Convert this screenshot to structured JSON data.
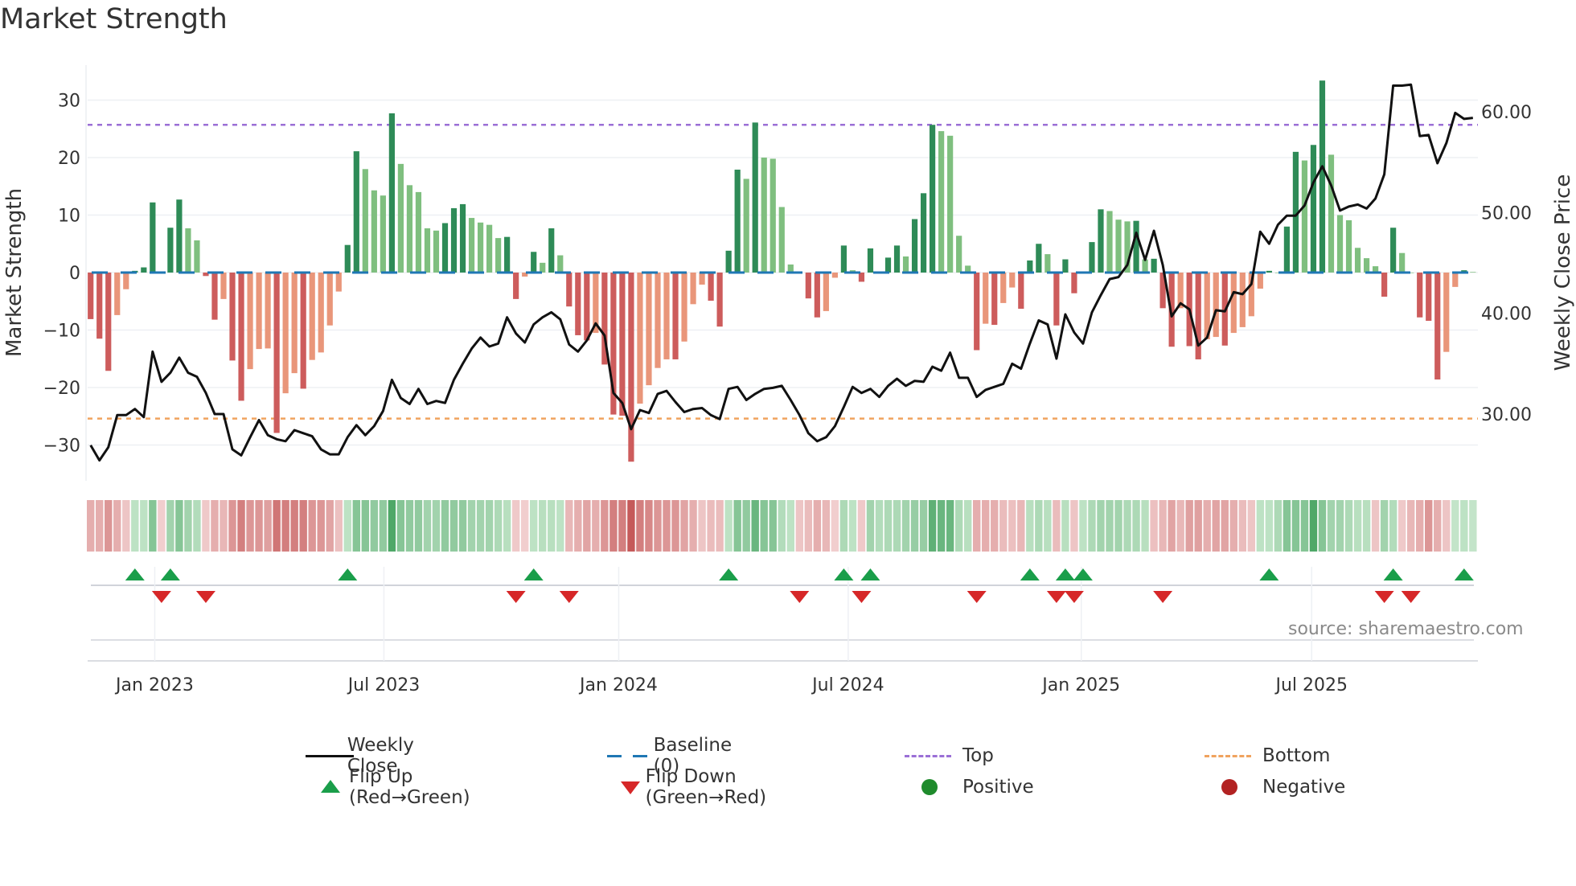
{
  "title": "Market Strength",
  "source": "source: sharemaestro.com",
  "legend": {
    "weekly_close": "Weekly Close",
    "baseline": "Baseline (0)",
    "top": "Top",
    "bottom": "Bottom",
    "flip_up": "Flip Up (Red→Green)",
    "flip_down": "Flip Down (Green→Red)",
    "positive": "Positive",
    "negative": "Negative"
  },
  "colors": {
    "price_line": "#111111",
    "baseline": "#1f77b4",
    "top": "#9b6fd6",
    "bottom": "#f0a35e",
    "bar_pos_rising": "#2e8b57",
    "bar_pos_falling": "#7fbf7f",
    "bar_neg_falling": "#cd5c5c",
    "bar_neg_rising": "#e9967a",
    "flip_up": "#1a9e4a",
    "flip_down": "#d62728",
    "positive": "#1f8b2c",
    "negative": "#b22222"
  },
  "chart_data": {
    "type": "bar",
    "title": "Market Strength",
    "ylabel": "Market Strength",
    "y2label": "Weekly Close Price",
    "ylim": [
      -36,
      36
    ],
    "y2lim": [
      23.4,
      64.6
    ],
    "yticks": [
      30,
      20,
      10,
      0,
      -10,
      -20,
      -30
    ],
    "ytick_labels": [
      "30",
      "20",
      "10",
      "0",
      "−10",
      "−20",
      "−30"
    ],
    "y2ticks": [
      60,
      50,
      40,
      30
    ],
    "y2tick_labels": [
      "60.00",
      "50.00",
      "40.00",
      "30.00"
    ],
    "xticks": [
      {
        "label": "Jan 2023",
        "week": 8.24
      },
      {
        "label": "Jul 2023",
        "week": 34.1
      },
      {
        "label": "Jan 2024",
        "week": 60.6
      },
      {
        "label": "Jul 2024",
        "week": 86.5
      },
      {
        "label": "Jan 2025",
        "week": 112.8
      },
      {
        "label": "Jul 2025",
        "week": 138.8
      }
    ],
    "top_level": 25.7,
    "bottom_level": -25.4,
    "baseline": 0,
    "strength": [
      -8.1,
      -11.5,
      -17.1,
      -7.4,
      -2.9,
      0.3,
      0.9,
      12.2,
      -0.2,
      7.8,
      12.7,
      7.7,
      5.6,
      -0.6,
      -8.2,
      -4.6,
      -15.3,
      -22.3,
      -16.8,
      -13.3,
      -13.2,
      -27.9,
      -21.0,
      -17.5,
      -20.2,
      -15.2,
      -13.9,
      -9.2,
      -3.3,
      4.8,
      21.1,
      18.0,
      14.3,
      13.4,
      27.7,
      18.9,
      15.2,
      14.0,
      7.7,
      7.3,
      8.6,
      11.2,
      11.9,
      9.5,
      8.7,
      8.3,
      6.0,
      6.2,
      -4.6,
      -0.7,
      3.6,
      1.7,
      7.7,
      3.0,
      -5.9,
      -10.9,
      -11.8,
      -10.5,
      -16.0,
      -24.7,
      -24.9,
      -32.9,
      -22.8,
      -19.6,
      -16.6,
      -15.1,
      -15.1,
      -12.0,
      -5.5,
      -2.1,
      -4.9,
      -9.4,
      3.8,
      17.9,
      16.3,
      26.1,
      20.0,
      19.8,
      11.4,
      1.4,
      0,
      -4.5,
      -7.8,
      -6.7,
      -0.9,
      4.7,
      0.4,
      -1.6,
      4.2,
      0.2,
      2.6,
      4.7,
      2.8,
      9.3,
      13.8,
      25.7,
      24.6,
      23.8,
      6.4,
      1.2,
      -13.5,
      -8.9,
      -9.1,
      -5.3,
      -2.6,
      -6.3,
      2.1,
      5.0,
      3.2,
      -9.2,
      2.3,
      -3.6,
      0.2,
      5.3,
      11.0,
      10.7,
      9.2,
      8.9,
      9.0,
      2.3,
      2.4,
      -6.2,
      -12.9,
      -6.2,
      -12.8,
      -15.1,
      -11.6,
      -11.2,
      -12.7,
      -10.5,
      -9.5,
      -7.6,
      -2.8,
      0.3,
      0,
      8.0,
      21.0,
      19.5,
      22.2,
      33.4,
      20.5,
      10.0,
      9.1,
      4.3,
      2.5,
      1.1,
      -4.2,
      7.8,
      3.4,
      0,
      -7.8,
      -8.4,
      -18.6,
      -13.8,
      -2.5,
      0.4,
      0.1
    ],
    "weekly_close": [
      26.9,
      25.4,
      26.7,
      29.9,
      29.9,
      30.5,
      29.7,
      36.2,
      33.2,
      34.1,
      35.6,
      34.1,
      33.7,
      32.1,
      30.0,
      30.0,
      26.5,
      25.9,
      27.7,
      29.4,
      27.9,
      27.5,
      27.3,
      28.4,
      28.1,
      27.8,
      26.5,
      26.0,
      26.0,
      27.7,
      28.9,
      27.9,
      28.8,
      30.3,
      33.4,
      31.6,
      31.0,
      32.5,
      31.0,
      31.3,
      31.1,
      33.4,
      35.0,
      36.5,
      37.6,
      36.7,
      37.0,
      39.6,
      38.0,
      37.1,
      38.9,
      39.6,
      40.1,
      39.4,
      36.9,
      36.2,
      37.3,
      39.0,
      37.8,
      32.1,
      31.1,
      28.5,
      30.4,
      30.1,
      32.0,
      32.3,
      31.2,
      30.2,
      30.5,
      30.6,
      29.9,
      29.5,
      32.5,
      32.7,
      31.4,
      32.0,
      32.5,
      32.6,
      32.8,
      31.4,
      29.9,
      28.1,
      27.3,
      27.7,
      28.8,
      30.7,
      32.7,
      32.1,
      32.5,
      31.7,
      32.8,
      33.5,
      32.8,
      33.3,
      33.2,
      34.7,
      34.3,
      36.1,
      33.6,
      33.6,
      31.7,
      32.4,
      32.7,
      33.0,
      35.0,
      34.5,
      37.0,
      39.3,
      38.9,
      35.5,
      39.9,
      38.1,
      37.0,
      40.1,
      41.8,
      43.4,
      43.6,
      44.8,
      48.0,
      45.3,
      48.2,
      44.8,
      39.7,
      41.0,
      40.4,
      36.8,
      37.6,
      40.3,
      40.2,
      42.1,
      41.9,
      42.9,
      48.1,
      46.9,
      48.8,
      49.7,
      49.7,
      50.7,
      53.0,
      54.6,
      52.7,
      50.2,
      50.6,
      50.8,
      50.4,
      51.4,
      53.8,
      62.6,
      62.6,
      62.7,
      57.6,
      57.7,
      54.9,
      56.9,
      59.9,
      59.3,
      59.4
    ],
    "heat_levels": [
      -1,
      -1,
      -1.5,
      -1,
      -0.5,
      0.5,
      0.5,
      1.5,
      -0.3,
      1,
      1.5,
      1,
      0.7,
      -0.4,
      -1,
      -0.8,
      -1.5,
      -2,
      -1.5,
      -1.5,
      -1.3,
      -2.2,
      -2,
      -2,
      -2,
      -1.5,
      -1.5,
      -1.2,
      -0.6,
      0.5,
      1.5,
      1.5,
      1.3,
      1.3,
      2.5,
      1.5,
      1.3,
      1.3,
      1,
      1,
      1.3,
      1.3,
      1.3,
      1,
      1,
      1,
      0.8,
      0.6,
      -0.4,
      -0.3,
      0.5,
      0.6,
      0.6,
      0.5,
      -0.8,
      -1,
      -1.2,
      -1,
      -1.5,
      -2,
      -2,
      -2.8,
      -2,
      -1.8,
      -1.5,
      -1.5,
      -1.5,
      -1.2,
      -1,
      -0.5,
      -0.7,
      -0.7,
      0.5,
      1.5,
      1.3,
      2,
      1.5,
      1.5,
      0.7,
      0.5,
      -0.5,
      -0.7,
      -1,
      -0.8,
      -0.3,
      0.8,
      0.5,
      -0.4,
      1,
      0.7,
      0.8,
      0.8,
      1,
      1.2,
      1.2,
      2.2,
      2,
      2,
      0.8,
      0.6,
      -1,
      -1,
      -1,
      -0.7,
      -0.6,
      -0.8,
      0.6,
      0.8,
      0.6,
      -0.7,
      0.6,
      -0.5,
      0.5,
      0.8,
      1,
      1,
      1,
      0.8,
      0.8,
      0.6,
      -0.6,
      -0.8,
      -1.2,
      -0.8,
      -1.3,
      -1.3,
      -1,
      -1.2,
      -1.2,
      -1,
      -0.7,
      -0.5,
      0.5,
      0.5,
      0.8,
      1.5,
      1.5,
      1.5,
      2.5,
      1.5,
      1,
      1,
      0.8,
      0.6,
      0.6,
      -0.5,
      1,
      0.7,
      -0.4,
      -0.8,
      -1,
      -1.5,
      -1,
      -0.5,
      0.4,
      0.5,
      0.4
    ],
    "flip_up_weeks": [
      6,
      10,
      30,
      51,
      73,
      86,
      89,
      107,
      111,
      113,
      134,
      148,
      156
    ],
    "flip_down_weeks": [
      9,
      14,
      49,
      55,
      81,
      88,
      101,
      110,
      112,
      122,
      147,
      150
    ]
  }
}
